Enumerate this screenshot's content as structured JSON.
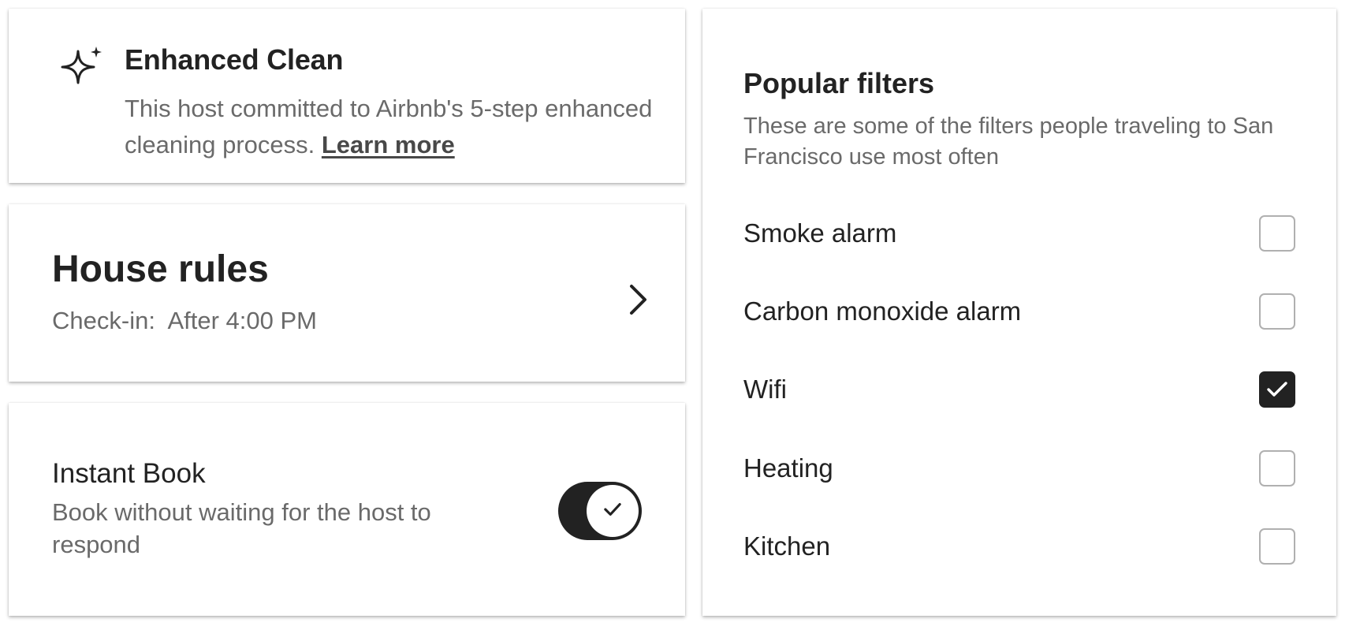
{
  "enhanced_clean": {
    "icon": "sparkle-icon",
    "title": "Enhanced Clean",
    "description": "This host committed to Airbnb's 5-step enhanced cleaning process.",
    "link": "Learn more"
  },
  "house_rules": {
    "title": "House rules",
    "checkin": "Check-in:  After 4:00 PM",
    "icon": "chevron-right-icon"
  },
  "instant_book": {
    "title": "Instant Book",
    "description": "Book without waiting for the host to respond",
    "toggle_on": true,
    "icon": "check-icon"
  },
  "popular_filters": {
    "title": "Popular filters",
    "description": "These are some of the filters people traveling to San Francisco use most often",
    "filters": [
      {
        "label": "Smoke alarm",
        "checked": false
      },
      {
        "label": "Carbon monoxide alarm",
        "checked": false
      },
      {
        "label": "Wifi",
        "checked": true
      },
      {
        "label": "Heating",
        "checked": false
      },
      {
        "label": "Kitchen",
        "checked": false
      }
    ]
  },
  "colors": {
    "text_primary": "#222222",
    "text_secondary": "#6a6a6a",
    "checkbox_border": "#b0b0b0",
    "accent_dark": "#222222"
  }
}
